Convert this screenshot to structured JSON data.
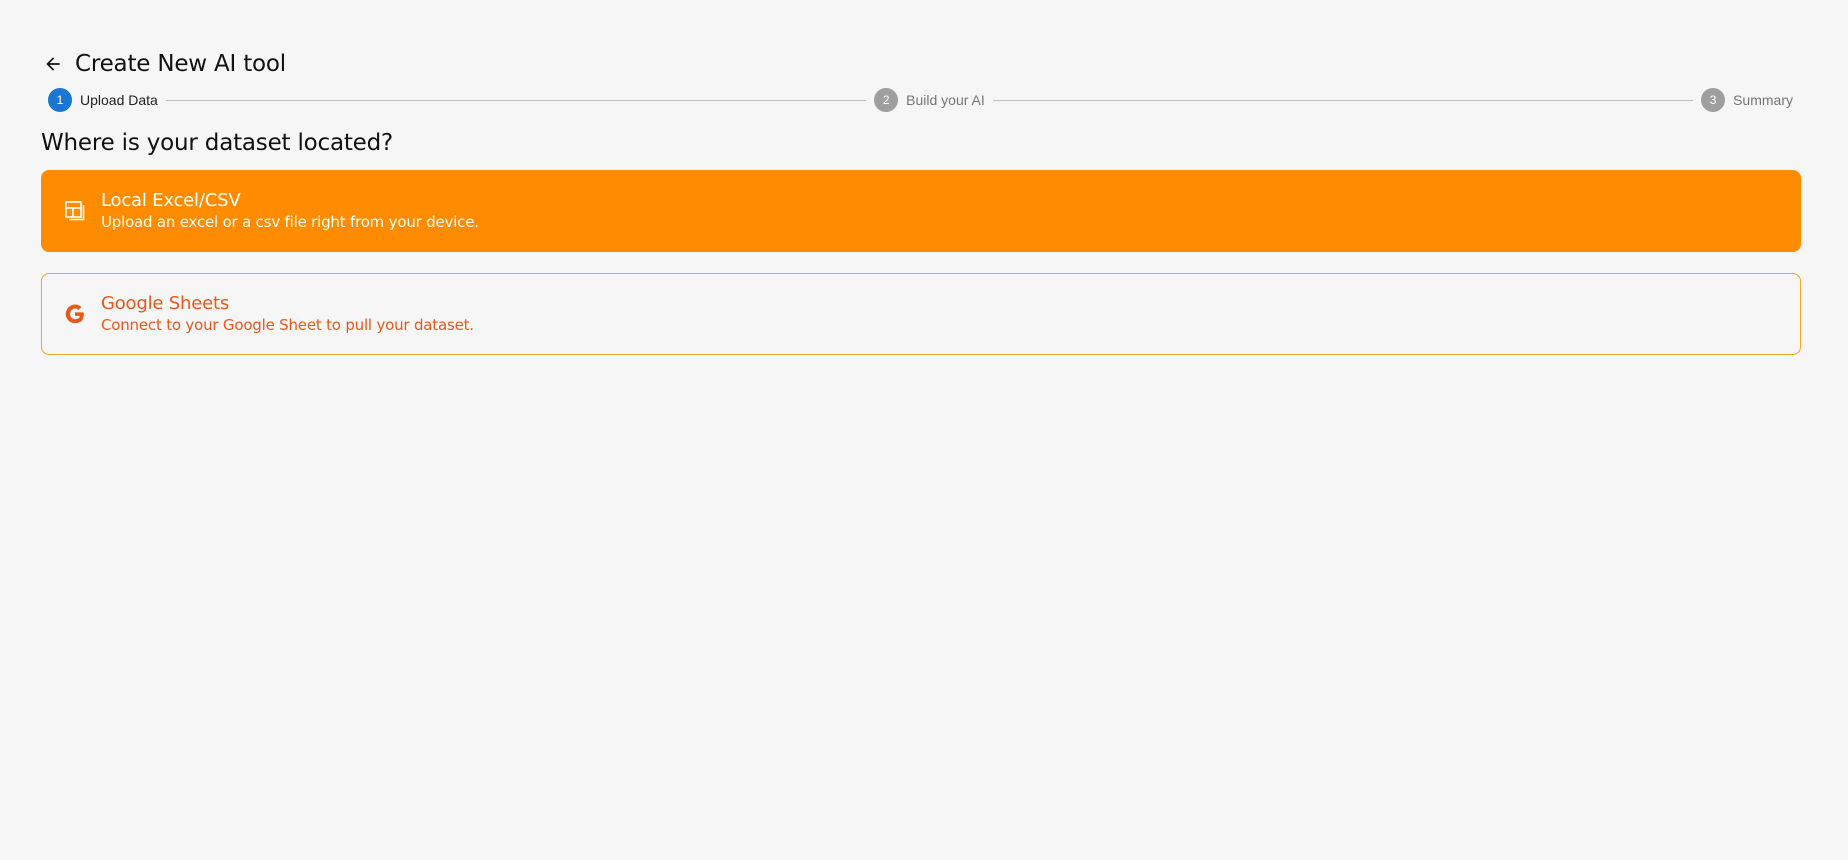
{
  "header": {
    "title": "Create New AI tool"
  },
  "stepper": {
    "steps": [
      {
        "number": "1",
        "label": "Upload Data",
        "state": "active"
      },
      {
        "number": "2",
        "label": "Build your AI",
        "state": "inactive"
      },
      {
        "number": "3",
        "label": "Summary",
        "state": "inactive"
      }
    ]
  },
  "question": "Where is your dataset located?",
  "options": [
    {
      "title": "Local Excel/CSV",
      "description": "Upload an excel or a csv file right from your device.",
      "icon": "spreadsheet-icon",
      "selected": true
    },
    {
      "title": "Google Sheets",
      "description": "Connect to your Google Sheet to pull your dataset.",
      "icon": "google-icon",
      "selected": false
    }
  ],
  "colors": {
    "accent_orange": "#ff8c00",
    "option_text_orange": "#e8581b",
    "option_border": "#f5a623",
    "step_active": "#1976d2",
    "step_inactive": "#9e9e9e",
    "background": "#f6f6f6"
  }
}
